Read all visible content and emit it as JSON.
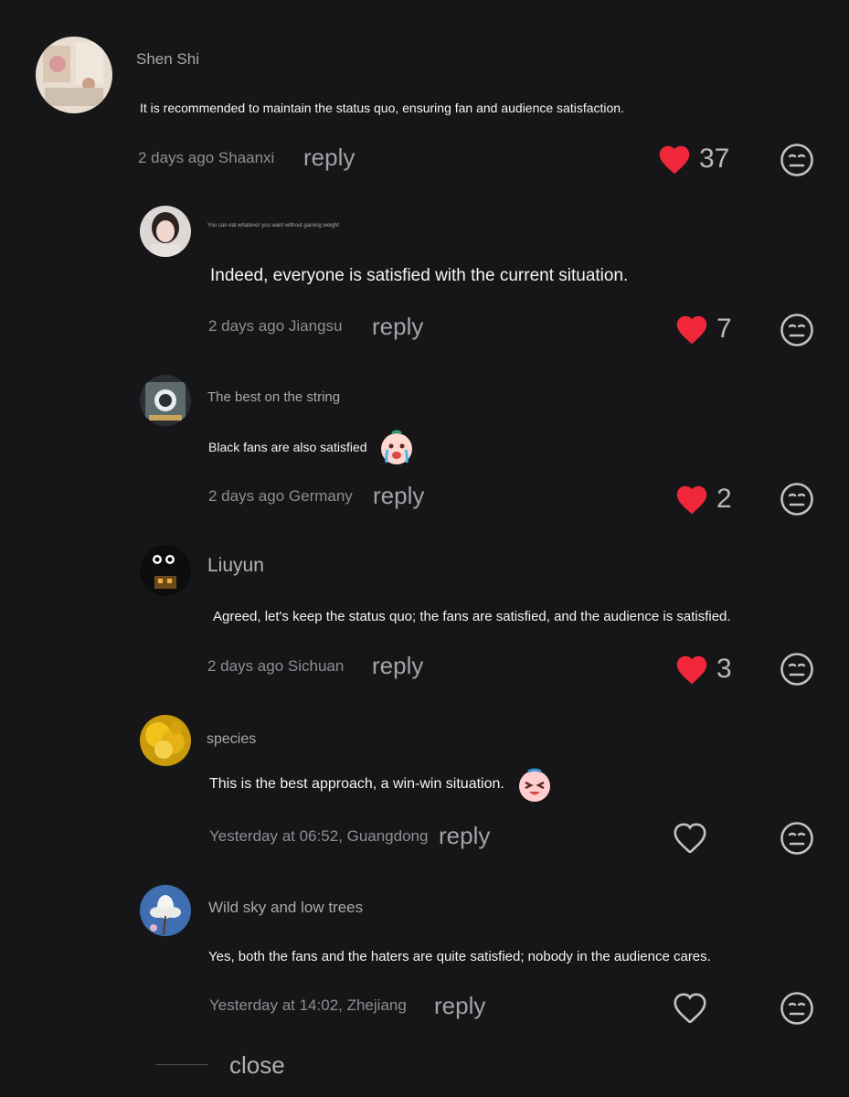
{
  "comments": [
    {
      "username": "Shen Shi",
      "text": "It is recommended to maintain the status quo, ensuring fan and audience satisfaction.",
      "meta": "2 days ago Shaanxi",
      "reply": "reply",
      "likes": "37",
      "liked": true
    },
    {
      "username": "You can eat whatever you want without gaining weight",
      "text": "Indeed, everyone is satisfied with the current situation.",
      "meta": "2 days ago Jiangsu",
      "reply": "reply",
      "likes": "7",
      "liked": true
    },
    {
      "username": "The best on the string",
      "text": "Black fans are also satisfied",
      "meta": "2 days ago Germany",
      "reply": "reply",
      "likes": "2",
      "liked": true
    },
    {
      "username": "Liuyun",
      "text": "Agreed, let's keep the status quo; the fans are satisfied, and the audience is satisfied.",
      "meta": "2 days ago Sichuan",
      "reply": "reply",
      "likes": "3",
      "liked": true
    },
    {
      "username": "species",
      "text": "This is the best approach, a win-win situation.",
      "meta": "Yesterday at 06:52, Guangdong",
      "reply": "reply",
      "likes": "",
      "liked": false
    },
    {
      "username": "Wild sky and low trees",
      "text": "Yes, both the fans and the haters are quite satisfied; nobody in the audience cares.",
      "meta": "Yesterday at 14:02, Zhejiang",
      "reply": "reply",
      "likes": "",
      "liked": false
    }
  ],
  "icons": {
    "like": "heart-icon",
    "reaction": "neutral-face-icon",
    "sticker_crying": "crying-face-sticker",
    "sticker_laughing": "laughing-face-sticker"
  },
  "colors": {
    "background": "#161618",
    "like_active": "#f0263a",
    "muted_text": "#8e8e93"
  },
  "footer": {
    "close_label": "close"
  }
}
